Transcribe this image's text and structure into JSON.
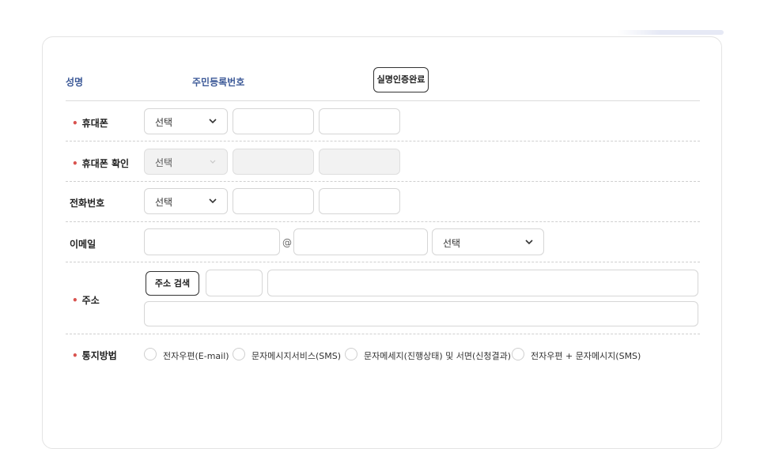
{
  "identity": {
    "name_label": "성명",
    "rrn_label": "주민등록번호",
    "verify_button": "실명인증완료"
  },
  "mobile": {
    "label": "휴대폰",
    "select_value": "선택"
  },
  "mobile_confirm": {
    "label": "휴대폰 확인",
    "select_value": "선택"
  },
  "phone": {
    "label": "전화번호",
    "select_value": "선택"
  },
  "email": {
    "label": "이메일",
    "at_sign": "@",
    "domain_select_value": "선택"
  },
  "address": {
    "label": "주소",
    "search_button": "주소 검색"
  },
  "notify": {
    "label": "통지방법",
    "options": [
      "전자우편(E-mail)",
      "문자메시지서비스(SMS)",
      "문자메세지(진행상태) 및 서면(신청결과)",
      "전자우편 + 문자메시지(SMS)"
    ]
  }
}
